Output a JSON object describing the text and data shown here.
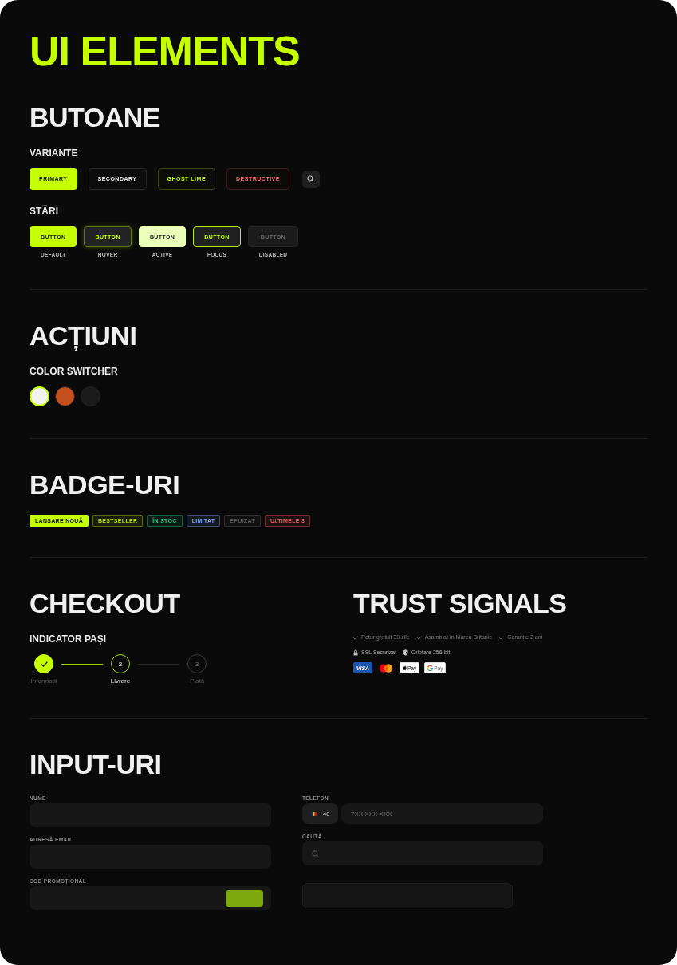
{
  "title": "UI ELEMENTS",
  "buttons": {
    "heading": "BUTOANE",
    "variants": {
      "label": "VARIANTE",
      "items": [
        {
          "kind": "primary",
          "label": "PRIMARY"
        },
        {
          "kind": "secondary",
          "label": "SECONDARY"
        },
        {
          "kind": "ghost",
          "label": "GHOST LIME"
        },
        {
          "kind": "destructive",
          "label": "DESTRUCTIVE"
        },
        {
          "kind": "icon"
        }
      ]
    },
    "states": {
      "label": "STĂRI",
      "items": [
        {
          "kind": "default",
          "label": "BUTTON",
          "caption": "DEFAULT"
        },
        {
          "kind": "hover",
          "label": "BUTTON",
          "caption": "HOVER"
        },
        {
          "kind": "active",
          "label": "BUTTON",
          "caption": "ACTIVE"
        },
        {
          "kind": "focus",
          "label": "BUTTON",
          "caption": "FOCUS"
        },
        {
          "kind": "disabled",
          "label": "BUTTON",
          "caption": "DISABLED"
        }
      ]
    }
  },
  "actions": {
    "heading": "ACȚIUNI",
    "color_switcher": {
      "label": "COLOR SWITCHER",
      "swatches": [
        {
          "color": "#f3f3ee",
          "selected": true
        },
        {
          "color": "#c4501f",
          "selected": false
        },
        {
          "color": "#1b1b1b",
          "selected": false
        }
      ]
    }
  },
  "badges": {
    "heading": "BADGE-URI",
    "items": [
      {
        "kind": "solid",
        "label": "LANSARE NOUĂ",
        "color": "#c6ff00"
      },
      {
        "kind": "outline",
        "label": "BESTSELLER",
        "color": "#b4e000"
      },
      {
        "kind": "outline",
        "label": "ÎN STOC",
        "color": "#34c98a"
      },
      {
        "kind": "outline",
        "label": "LIMITAT",
        "color": "#7ea6f2"
      },
      {
        "kind": "outline",
        "label": "EPUIZAT",
        "color": "#5a5a5a"
      },
      {
        "kind": "outline",
        "label": "ULTIMELE 3",
        "color": "#e85d5d"
      }
    ]
  },
  "checkout": {
    "heading": "CHECKOUT",
    "steps_label": "INDICATOR PAȘI",
    "steps": [
      {
        "completed": true,
        "selected": false,
        "label": "Informații"
      },
      {
        "completed": false,
        "selected": true,
        "number": "2",
        "label": "Livrare"
      },
      {
        "completed": false,
        "selected": false,
        "number": "3",
        "label": "Plată"
      }
    ]
  },
  "trust_signals": {
    "heading": "TRUST SIGNALS",
    "perks": [
      "Retur gratuit 30 zile",
      "Asamblat în Marea Britanie",
      "Garanție 2 ani"
    ],
    "security": [
      {
        "kind": "lock",
        "label": "SSL Securizat"
      },
      {
        "kind": "shield",
        "label": "Criptare 256-bit"
      }
    ],
    "payments": [
      {
        "kind": "visa",
        "label": "VISA"
      },
      {
        "kind": "mastercard"
      },
      {
        "kind": "apple_pay",
        "label": "Pay"
      },
      {
        "kind": "google_pay",
        "label": "Pay"
      }
    ]
  },
  "inputs": {
    "heading": "INPUT-URI",
    "columns": [
      [
        {
          "kind": "text",
          "label": "NUME"
        },
        {
          "kind": "text",
          "label": "ADRESĂ EMAIL"
        },
        {
          "kind": "promo",
          "label": "COD PROMOȚIONAL"
        }
      ],
      [
        {
          "kind": "phone",
          "label": "TELEFON",
          "prefix": "+40",
          "placeholder": "7XX XXX XXX"
        },
        {
          "kind": "search",
          "label": "CAUTĂ"
        },
        {
          "kind": "area"
        }
      ]
    ]
  }
}
